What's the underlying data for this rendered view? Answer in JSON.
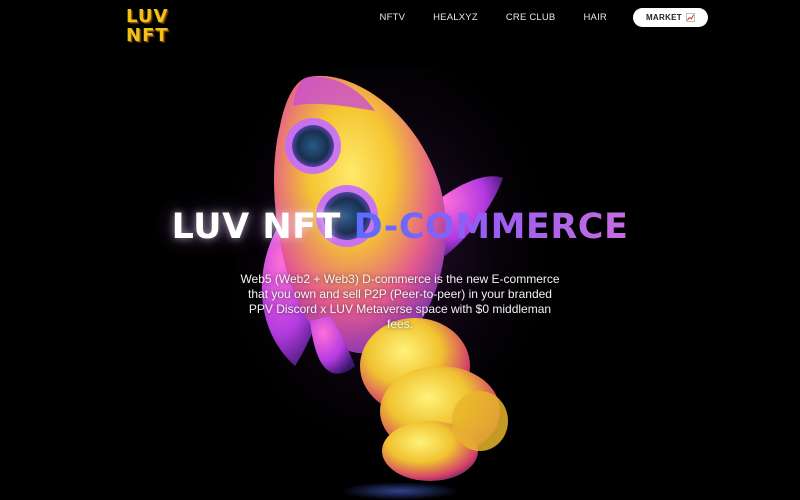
{
  "brand": {
    "logo_line1": "LUV",
    "logo_line2": "NFT"
  },
  "nav": {
    "items": [
      {
        "label": "NFTV"
      },
      {
        "label": "HEALXYZ"
      },
      {
        "label": "CRE CLUB"
      },
      {
        "label": "HAIR"
      }
    ],
    "market_label": "MARKET",
    "market_icon": "chart-up-icon"
  },
  "hero": {
    "title_part1": "LUV NFT",
    "title_part2": "D-COMMERCE",
    "description": "Web5 (Web2 + Web3) D-commerce is the new E-commerce that you own and sell P2P (Peer-to-peer) in your branded PPV Discord x LUV Metaverse space with $0 middleman fees."
  },
  "colors": {
    "background": "#000000",
    "logo": "#f2c21a",
    "accent_gradient_start": "#5b6cff",
    "accent_gradient_end": "#c86de0",
    "button_bg": "#ffffff"
  }
}
